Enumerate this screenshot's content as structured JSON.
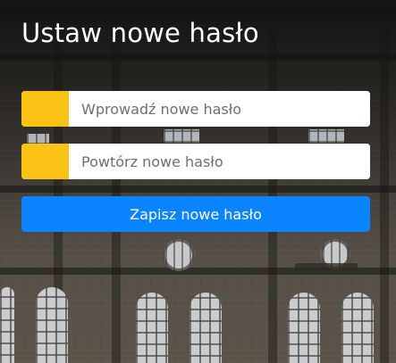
{
  "page": {
    "title": "Ustaw nowe hasło"
  },
  "form": {
    "new_password": {
      "value": "",
      "placeholder": "Wprowadź nowe hasło",
      "type": "password"
    },
    "repeat_password": {
      "value": "",
      "placeholder": "Powtórz nowe hasło",
      "type": "password"
    },
    "submit_label": "Zapisz nowe hasło"
  },
  "colors": {
    "accent_yellow": "#fbc216",
    "button_blue": "#0a84ff",
    "title_text": "#ffffff"
  }
}
